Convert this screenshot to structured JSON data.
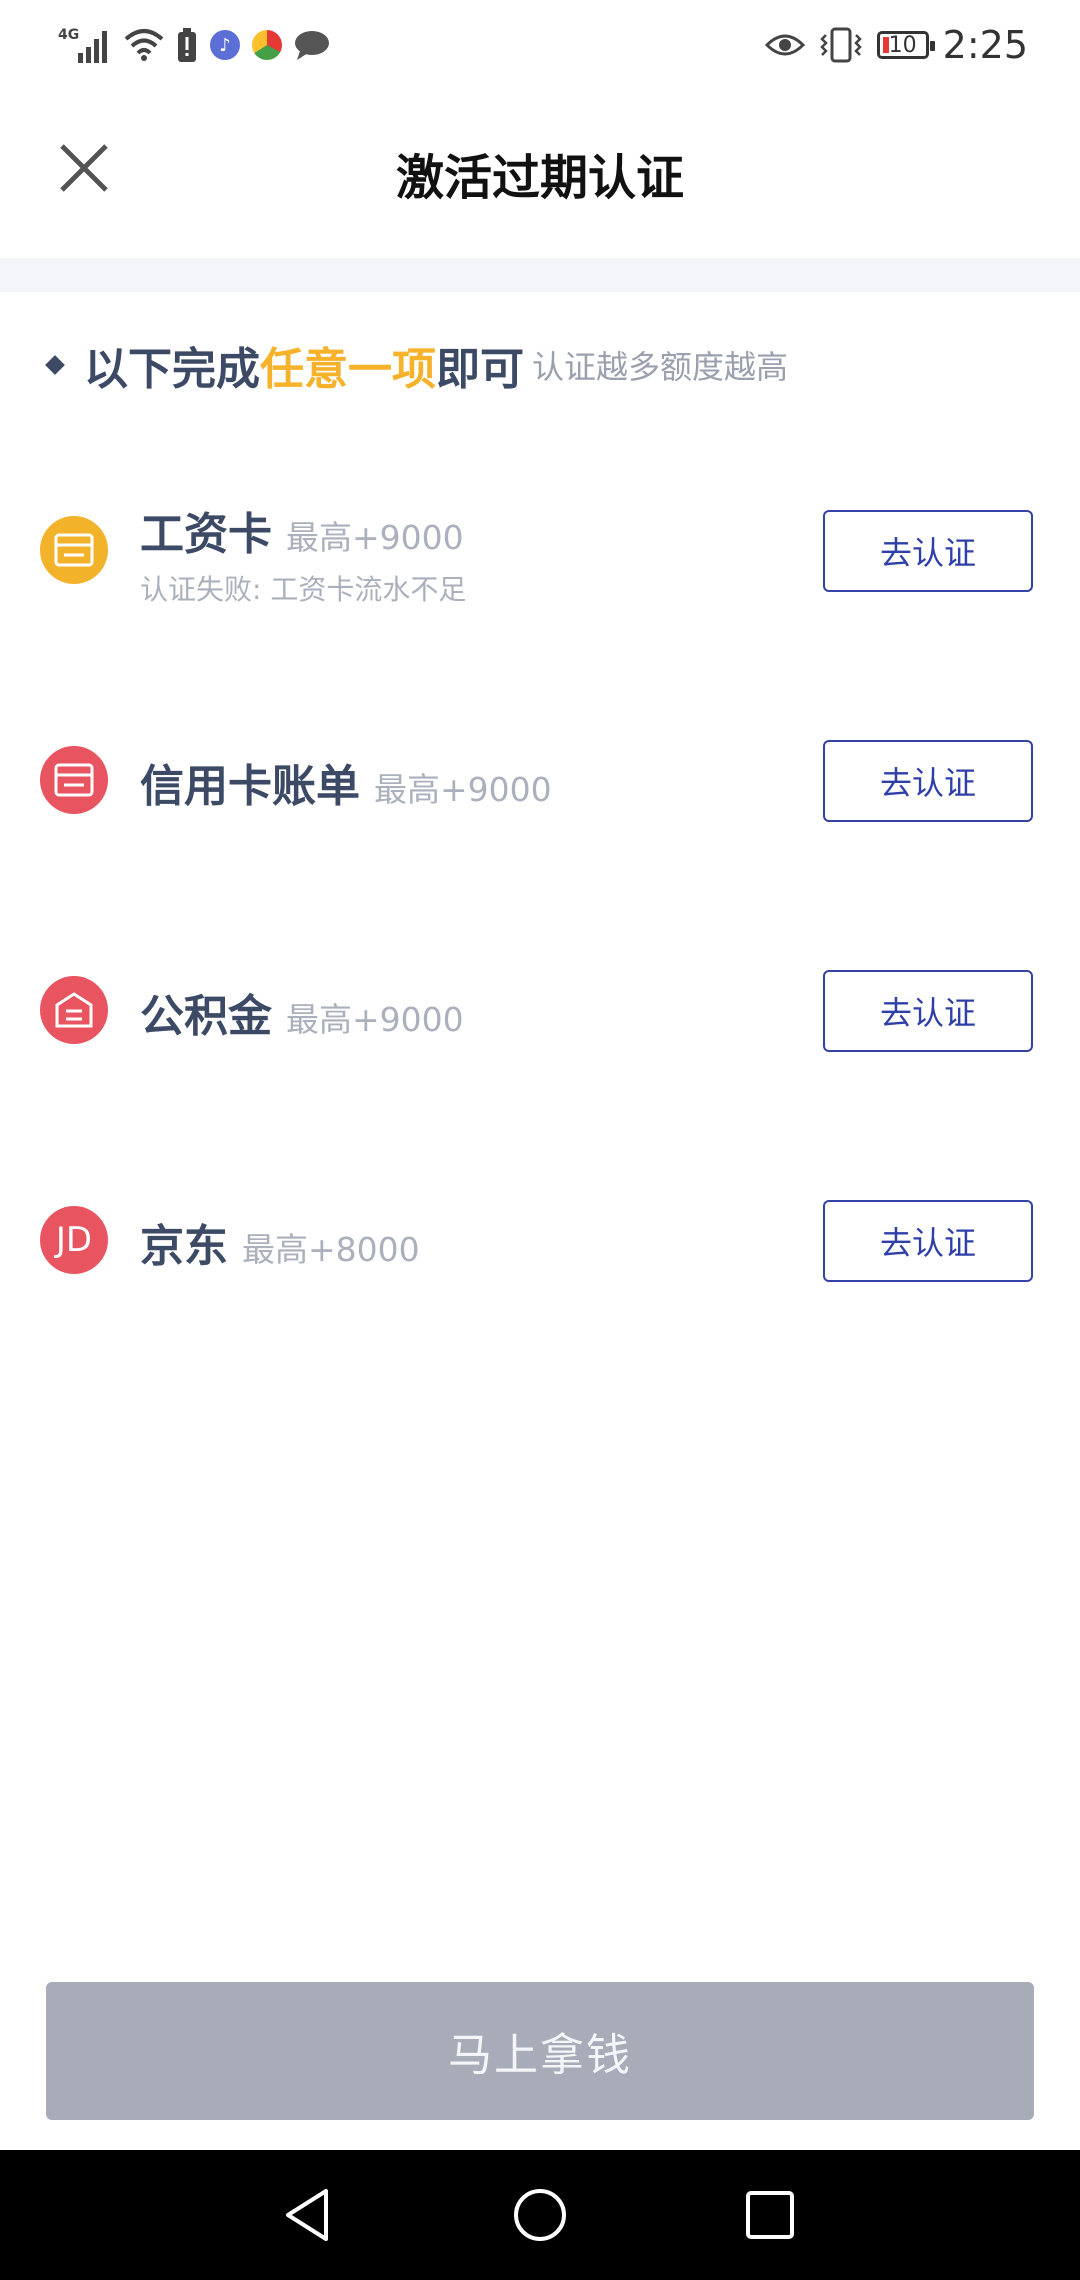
{
  "status_bar": {
    "network": "4G",
    "time": "2:25",
    "battery": "10",
    "colors": {
      "battery_low": "#e53935"
    },
    "icons": [
      "signal-icon",
      "wifi-icon",
      "battery-alert-icon",
      "music-app-icon",
      "browser-app-icon",
      "chat-app-icon",
      "eye-comfort-icon",
      "vibrate-icon",
      "battery-icon"
    ]
  },
  "header": {
    "title": "激活过期认证",
    "close_icon": "close-icon"
  },
  "subtitle": {
    "part1": "以下完成",
    "highlight": "任意一项",
    "part2": "即可",
    "note": "认证越多额度越高",
    "highlight_color": "#f5b22a"
  },
  "items": [
    {
      "name": "工资卡",
      "limit": "最高+9000",
      "note": "认证失败: 工资卡流水不足",
      "button": "去认证",
      "icon": "salary-card-icon",
      "icon_color": "#f2b32b"
    },
    {
      "name": "信用卡账单",
      "limit": "最高+9000",
      "button": "去认证",
      "icon": "credit-card-icon",
      "icon_color": "#e8545f"
    },
    {
      "name": "公积金",
      "limit": "最高+9000",
      "button": "去认证",
      "icon": "housing-fund-icon",
      "icon_color": "#e8545f"
    },
    {
      "name": "京东",
      "limit": "最高+8000",
      "button": "去认证",
      "icon": "jd-icon",
      "icon_text": "JD",
      "icon_color": "#e8545f"
    }
  ],
  "actions": {
    "primary": "马上拿钱"
  },
  "nav": {
    "icons": [
      "back-nav-icon",
      "home-nav-icon",
      "recents-nav-icon"
    ]
  }
}
